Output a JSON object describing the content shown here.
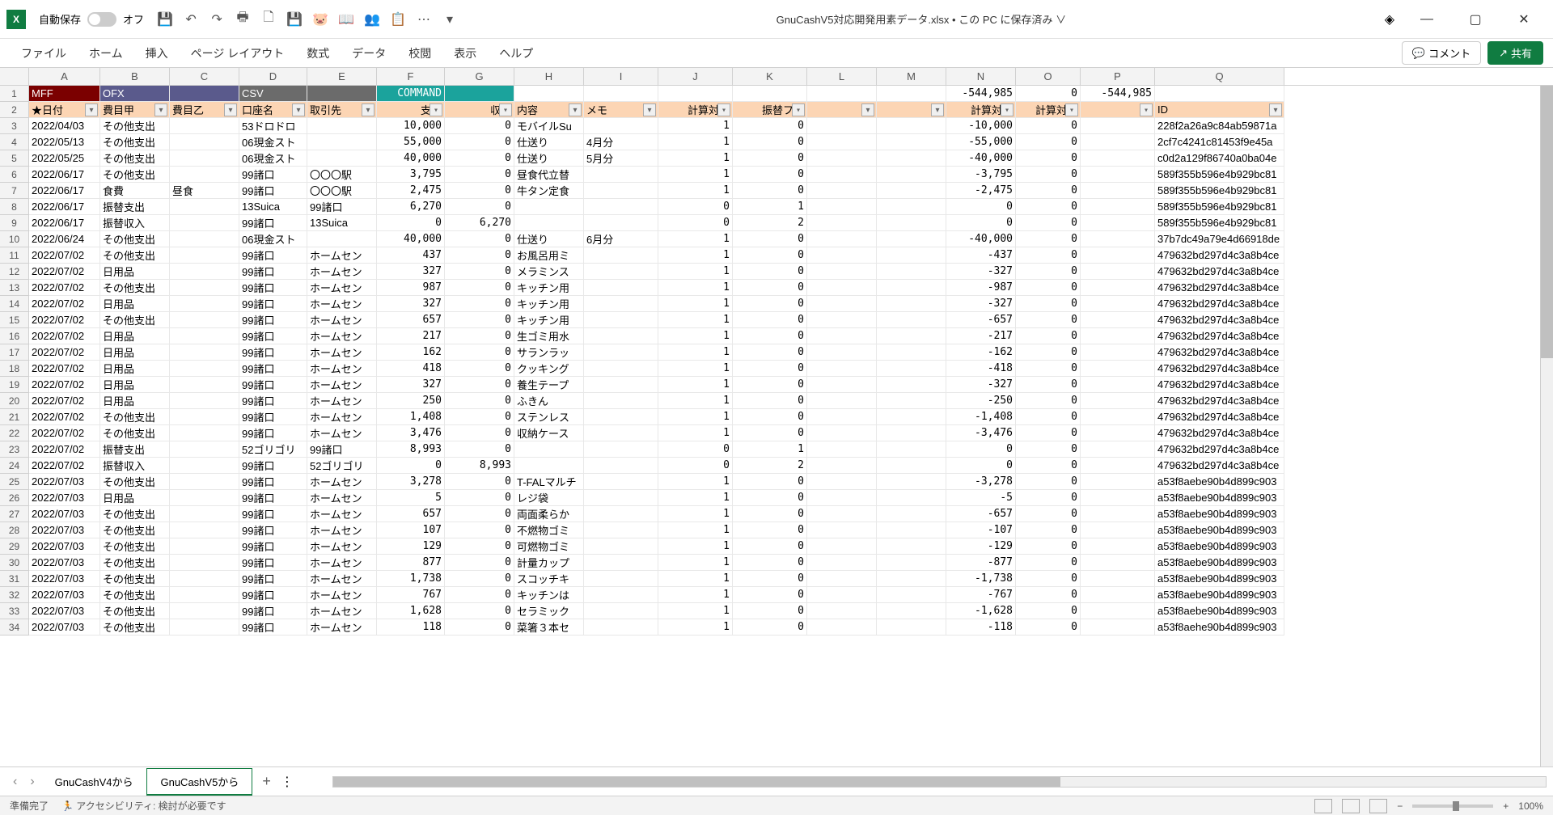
{
  "title": "GnuCashV5対応開発用素データ.xlsx • この PC に保存済み ∨",
  "autosave": {
    "label": "自動保存",
    "state": "オフ"
  },
  "ribbon": [
    "ファイル",
    "ホーム",
    "挿入",
    "ページ レイアウト",
    "数式",
    "データ",
    "校閲",
    "表示",
    "ヘルプ"
  ],
  "comment_btn": "コメント",
  "share_btn": "共有",
  "cols": [
    "A",
    "B",
    "C",
    "D",
    "E",
    "F",
    "G",
    "H",
    "I",
    "J",
    "K",
    "L",
    "M",
    "N",
    "O",
    "P",
    "Q"
  ],
  "row1": {
    "A": "MFF",
    "B": "OFX",
    "D": "CSV",
    "F": "COMMAND",
    "N": "-544,985",
    "O": "0",
    "P": "-544,985"
  },
  "row2": {
    "A": "★日付",
    "B": "費目甲",
    "C": "費目乙",
    "D": "口座名",
    "E": "取引先",
    "F": "支出",
    "G": "収入",
    "H": "内容",
    "I": "メモ",
    "J": "計算対象",
    "K": "振替フラ",
    "N": "計算対象",
    "O": "計算対象",
    "Q": "ID"
  },
  "data": [
    {
      "r": 3,
      "A": "2022/04/03",
      "B": "その他支出",
      "D": "53ドロドロ",
      "F": "10,000",
      "G": "0",
      "H": "モバイルSu",
      "J": "1",
      "K": "0",
      "N": "-10,000",
      "O": "0",
      "Q": "228f2a26a9c84ab59871a"
    },
    {
      "r": 4,
      "A": "2022/05/13",
      "B": "その他支出",
      "D": "06現金スト",
      "F": "55,000",
      "G": "0",
      "H": "仕送り",
      "I": "4月分",
      "J": "1",
      "K": "0",
      "N": "-55,000",
      "O": "0",
      "Q": "2cf7c4241c81453f9e45a"
    },
    {
      "r": 5,
      "A": "2022/05/25",
      "B": "その他支出",
      "D": "06現金スト",
      "F": "40,000",
      "G": "0",
      "H": "仕送り",
      "I": "5月分",
      "J": "1",
      "K": "0",
      "N": "-40,000",
      "O": "0",
      "Q": "c0d2a129f86740a0ba04e"
    },
    {
      "r": 6,
      "A": "2022/06/17",
      "B": "その他支出",
      "D": "99諸口",
      "E": "〇〇〇駅",
      "F": "3,795",
      "G": "0",
      "H": "昼食代立替",
      "J": "1",
      "K": "0",
      "N": "-3,795",
      "O": "0",
      "Q": "589f355b596e4b929bc81"
    },
    {
      "r": 7,
      "A": "2022/06/17",
      "B": "食費",
      "C": "昼食",
      "D": "99諸口",
      "E": "〇〇〇駅",
      "F": "2,475",
      "G": "0",
      "H": "牛タン定食",
      "J": "1",
      "K": "0",
      "N": "-2,475",
      "O": "0",
      "Q": "589f355b596e4b929bc81"
    },
    {
      "r": 8,
      "A": "2022/06/17",
      "B": "振替支出",
      "D": "13Suica",
      "E": "99諸口",
      "F": "6,270",
      "G": "0",
      "J": "0",
      "K": "1",
      "N": "0",
      "O": "0",
      "Q": "589f355b596e4b929bc81"
    },
    {
      "r": 9,
      "A": "2022/06/17",
      "B": "振替収入",
      "D": "99諸口",
      "E": "13Suica",
      "F": "0",
      "G": "6,270",
      "J": "0",
      "K": "2",
      "N": "0",
      "O": "0",
      "Q": "589f355b596e4b929bc81"
    },
    {
      "r": 10,
      "A": "2022/06/24",
      "B": "その他支出",
      "D": "06現金スト",
      "F": "40,000",
      "G": "0",
      "H": "仕送り",
      "I": "6月分",
      "J": "1",
      "K": "0",
      "N": "-40,000",
      "O": "0",
      "Q": "37b7dc49a79e4d66918de"
    },
    {
      "r": 11,
      "A": "2022/07/02",
      "B": "その他支出",
      "D": "99諸口",
      "E": "ホームセン",
      "F": "437",
      "G": "0",
      "H": "お風呂用ミ",
      "J": "1",
      "K": "0",
      "N": "-437",
      "O": "0",
      "Q": "479632bd297d4c3a8b4ce"
    },
    {
      "r": 12,
      "A": "2022/07/02",
      "B": "日用品",
      "D": "99諸口",
      "E": "ホームセン",
      "F": "327",
      "G": "0",
      "H": "メラミンス",
      "J": "1",
      "K": "0",
      "N": "-327",
      "O": "0",
      "Q": "479632bd297d4c3a8b4ce"
    },
    {
      "r": 13,
      "A": "2022/07/02",
      "B": "その他支出",
      "D": "99諸口",
      "E": "ホームセン",
      "F": "987",
      "G": "0",
      "H": "キッチン用",
      "J": "1",
      "K": "0",
      "N": "-987",
      "O": "0",
      "Q": "479632bd297d4c3a8b4ce"
    },
    {
      "r": 14,
      "A": "2022/07/02",
      "B": "日用品",
      "D": "99諸口",
      "E": "ホームセン",
      "F": "327",
      "G": "0",
      "H": "キッチン用",
      "J": "1",
      "K": "0",
      "N": "-327",
      "O": "0",
      "Q": "479632bd297d4c3a8b4ce"
    },
    {
      "r": 15,
      "A": "2022/07/02",
      "B": "その他支出",
      "D": "99諸口",
      "E": "ホームセン",
      "F": "657",
      "G": "0",
      "H": "キッチン用",
      "J": "1",
      "K": "0",
      "N": "-657",
      "O": "0",
      "Q": "479632bd297d4c3a8b4ce"
    },
    {
      "r": 16,
      "A": "2022/07/02",
      "B": "日用品",
      "D": "99諸口",
      "E": "ホームセン",
      "F": "217",
      "G": "0",
      "H": "生ゴミ用水",
      "J": "1",
      "K": "0",
      "N": "-217",
      "O": "0",
      "Q": "479632bd297d4c3a8b4ce"
    },
    {
      "r": 17,
      "A": "2022/07/02",
      "B": "日用品",
      "D": "99諸口",
      "E": "ホームセン",
      "F": "162",
      "G": "0",
      "H": "サランラッ",
      "J": "1",
      "K": "0",
      "N": "-162",
      "O": "0",
      "Q": "479632bd297d4c3a8b4ce"
    },
    {
      "r": 18,
      "A": "2022/07/02",
      "B": "日用品",
      "D": "99諸口",
      "E": "ホームセン",
      "F": "418",
      "G": "0",
      "H": "クッキング",
      "J": "1",
      "K": "0",
      "N": "-418",
      "O": "0",
      "Q": "479632bd297d4c3a8b4ce"
    },
    {
      "r": 19,
      "A": "2022/07/02",
      "B": "日用品",
      "D": "99諸口",
      "E": "ホームセン",
      "F": "327",
      "G": "0",
      "H": "養生テープ",
      "J": "1",
      "K": "0",
      "N": "-327",
      "O": "0",
      "Q": "479632bd297d4c3a8b4ce"
    },
    {
      "r": 20,
      "A": "2022/07/02",
      "B": "日用品",
      "D": "99諸口",
      "E": "ホームセン",
      "F": "250",
      "G": "0",
      "H": "ふきん",
      "J": "1",
      "K": "0",
      "N": "-250",
      "O": "0",
      "Q": "479632bd297d4c3a8b4ce"
    },
    {
      "r": 21,
      "A": "2022/07/02",
      "B": "その他支出",
      "D": "99諸口",
      "E": "ホームセン",
      "F": "1,408",
      "G": "0",
      "H": "ステンレス",
      "J": "1",
      "K": "0",
      "N": "-1,408",
      "O": "0",
      "Q": "479632bd297d4c3a8b4ce"
    },
    {
      "r": 22,
      "A": "2022/07/02",
      "B": "その他支出",
      "D": "99諸口",
      "E": "ホームセン",
      "F": "3,476",
      "G": "0",
      "H": "収納ケース",
      "J": "1",
      "K": "0",
      "N": "-3,476",
      "O": "0",
      "Q": "479632bd297d4c3a8b4ce"
    },
    {
      "r": 23,
      "A": "2022/07/02",
      "B": "振替支出",
      "D": "52ゴリゴリ",
      "E": "99諸口",
      "F": "8,993",
      "G": "0",
      "J": "0",
      "K": "1",
      "N": "0",
      "O": "0",
      "Q": "479632bd297d4c3a8b4ce"
    },
    {
      "r": 24,
      "A": "2022/07/02",
      "B": "振替収入",
      "D": "99諸口",
      "E": "52ゴリゴリ",
      "F": "0",
      "G": "8,993",
      "J": "0",
      "K": "2",
      "N": "0",
      "O": "0",
      "Q": "479632bd297d4c3a8b4ce"
    },
    {
      "r": 25,
      "A": "2022/07/03",
      "B": "その他支出",
      "D": "99諸口",
      "E": "ホームセン",
      "F": "3,278",
      "G": "0",
      "H": "T-FALマルチ",
      "J": "1",
      "K": "0",
      "N": "-3,278",
      "O": "0",
      "Q": "a53f8aebe90b4d899c903"
    },
    {
      "r": 26,
      "A": "2022/07/03",
      "B": "日用品",
      "D": "99諸口",
      "E": "ホームセン",
      "F": "5",
      "G": "0",
      "H": "レジ袋",
      "J": "1",
      "K": "0",
      "N": "-5",
      "O": "0",
      "Q": "a53f8aebe90b4d899c903"
    },
    {
      "r": 27,
      "A": "2022/07/03",
      "B": "その他支出",
      "D": "99諸口",
      "E": "ホームセン",
      "F": "657",
      "G": "0",
      "H": "両面柔らか",
      "J": "1",
      "K": "0",
      "N": "-657",
      "O": "0",
      "Q": "a53f8aebe90b4d899c903"
    },
    {
      "r": 28,
      "A": "2022/07/03",
      "B": "その他支出",
      "D": "99諸口",
      "E": "ホームセン",
      "F": "107",
      "G": "0",
      "H": "不燃物ゴミ",
      "J": "1",
      "K": "0",
      "N": "-107",
      "O": "0",
      "Q": "a53f8aebe90b4d899c903"
    },
    {
      "r": 29,
      "A": "2022/07/03",
      "B": "その他支出",
      "D": "99諸口",
      "E": "ホームセン",
      "F": "129",
      "G": "0",
      "H": "可燃物ゴミ",
      "J": "1",
      "K": "0",
      "N": "-129",
      "O": "0",
      "Q": "a53f8aebe90b4d899c903"
    },
    {
      "r": 30,
      "A": "2022/07/03",
      "B": "その他支出",
      "D": "99諸口",
      "E": "ホームセン",
      "F": "877",
      "G": "0",
      "H": "計量カップ",
      "J": "1",
      "K": "0",
      "N": "-877",
      "O": "0",
      "Q": "a53f8aebe90b4d899c903"
    },
    {
      "r": 31,
      "A": "2022/07/03",
      "B": "その他支出",
      "D": "99諸口",
      "E": "ホームセン",
      "F": "1,738",
      "G": "0",
      "H": "スコッチキ",
      "J": "1",
      "K": "0",
      "N": "-1,738",
      "O": "0",
      "Q": "a53f8aebe90b4d899c903"
    },
    {
      "r": 32,
      "A": "2022/07/03",
      "B": "その他支出",
      "D": "99諸口",
      "E": "ホームセン",
      "F": "767",
      "G": "0",
      "H": "キッチンは",
      "J": "1",
      "K": "0",
      "N": "-767",
      "O": "0",
      "Q": "a53f8aebe90b4d899c903"
    },
    {
      "r": 33,
      "A": "2022/07/03",
      "B": "その他支出",
      "D": "99諸口",
      "E": "ホームセン",
      "F": "1,628",
      "G": "0",
      "H": "セラミック",
      "J": "1",
      "K": "0",
      "N": "-1,628",
      "O": "0",
      "Q": "a53f8aebe90b4d899c903"
    },
    {
      "r": 34,
      "A": "2022/07/03",
      "B": "その他支出",
      "D": "99諸口",
      "E": "ホームセン",
      "F": "118",
      "G": "0",
      "H": "菜箸３本セ",
      "J": "1",
      "K": "0",
      "N": "-118",
      "O": "0",
      "Q": "a53f8aehe90b4d899c903"
    }
  ],
  "sheets": [
    "GnuCashV4から",
    "GnuCashV5から"
  ],
  "active_sheet": 1,
  "status": {
    "ready": "準備完了",
    "a11y": "アクセシビリティ: 検討が必要です",
    "zoom": "100%"
  }
}
